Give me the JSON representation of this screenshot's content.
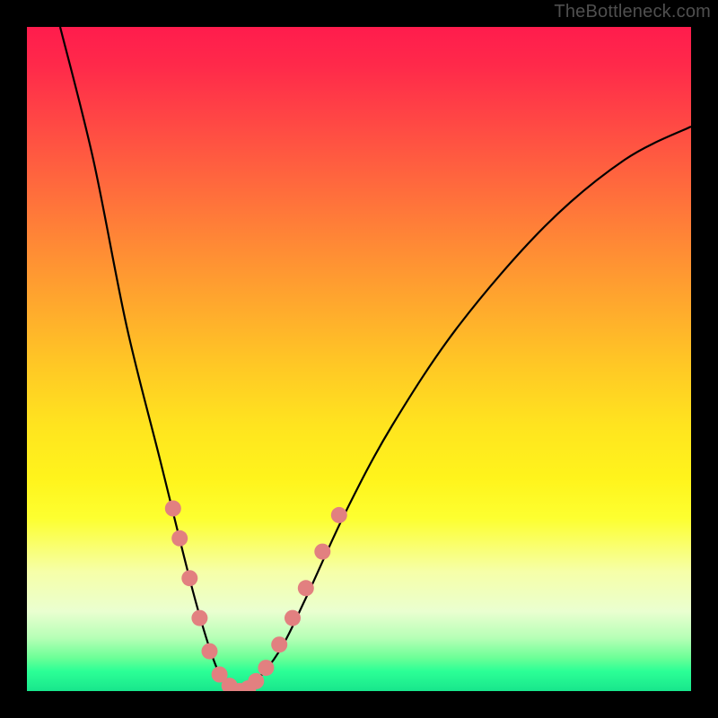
{
  "watermark": "TheBottleneck.com",
  "chart_data": {
    "type": "line",
    "title": "",
    "xlabel": "",
    "ylabel": "",
    "xlim": [
      0,
      100
    ],
    "ylim": [
      0,
      100
    ],
    "series": [
      {
        "name": "bottleneck-curve",
        "x": [
          5,
          10,
          15,
          20,
          25,
          28,
          30,
          32,
          34,
          38,
          42,
          48,
          55,
          65,
          78,
          90,
          100
        ],
        "y": [
          100,
          80,
          55,
          35,
          15,
          5,
          1,
          0,
          1,
          6,
          14,
          27,
          40,
          55,
          70,
          80,
          85
        ]
      }
    ],
    "markers": {
      "name": "data-beads",
      "color": "#e28080",
      "points": [
        {
          "x": 22.0,
          "y": 27.5
        },
        {
          "x": 23.0,
          "y": 23.0
        },
        {
          "x": 24.5,
          "y": 17.0
        },
        {
          "x": 26.0,
          "y": 11.0
        },
        {
          "x": 27.5,
          "y": 6.0
        },
        {
          "x": 29.0,
          "y": 2.5
        },
        {
          "x": 30.5,
          "y": 0.8
        },
        {
          "x": 32.0,
          "y": 0.0
        },
        {
          "x": 33.3,
          "y": 0.4
        },
        {
          "x": 34.5,
          "y": 1.5
        },
        {
          "x": 36.0,
          "y": 3.5
        },
        {
          "x": 38.0,
          "y": 7.0
        },
        {
          "x": 40.0,
          "y": 11.0
        },
        {
          "x": 42.0,
          "y": 15.5
        },
        {
          "x": 44.5,
          "y": 21.0
        },
        {
          "x": 47.0,
          "y": 26.5
        }
      ]
    },
    "background_gradient": {
      "stops": [
        {
          "pos": 0.0,
          "color": "#ff1c4d"
        },
        {
          "pos": 0.5,
          "color": "#ffd122"
        },
        {
          "pos": 0.85,
          "color": "#f6ffc0"
        },
        {
          "pos": 1.0,
          "color": "#18e68c"
        }
      ]
    }
  }
}
